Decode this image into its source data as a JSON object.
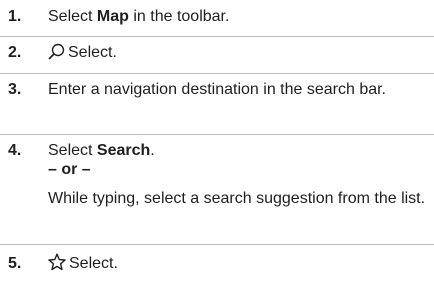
{
  "steps": [
    {
      "number": "1.",
      "text_before": "Select ",
      "bold": "Map",
      "text_after": " in the toolbar."
    },
    {
      "number": "2.",
      "icon": "search-icon",
      "text": "Select."
    },
    {
      "number": "3.",
      "text": "Enter a navigation destination in the search bar."
    },
    {
      "number": "4.",
      "text_before": "Select ",
      "bold": "Search",
      "text_after": ".",
      "or_label": "– or –",
      "alt_text": "While typing, select a search suggestion from the list."
    },
    {
      "number": "5.",
      "icon": "star-icon",
      "text": "Select."
    }
  ],
  "colors": {
    "text": "#1f1f1f",
    "divider": "#b9bcbf"
  }
}
